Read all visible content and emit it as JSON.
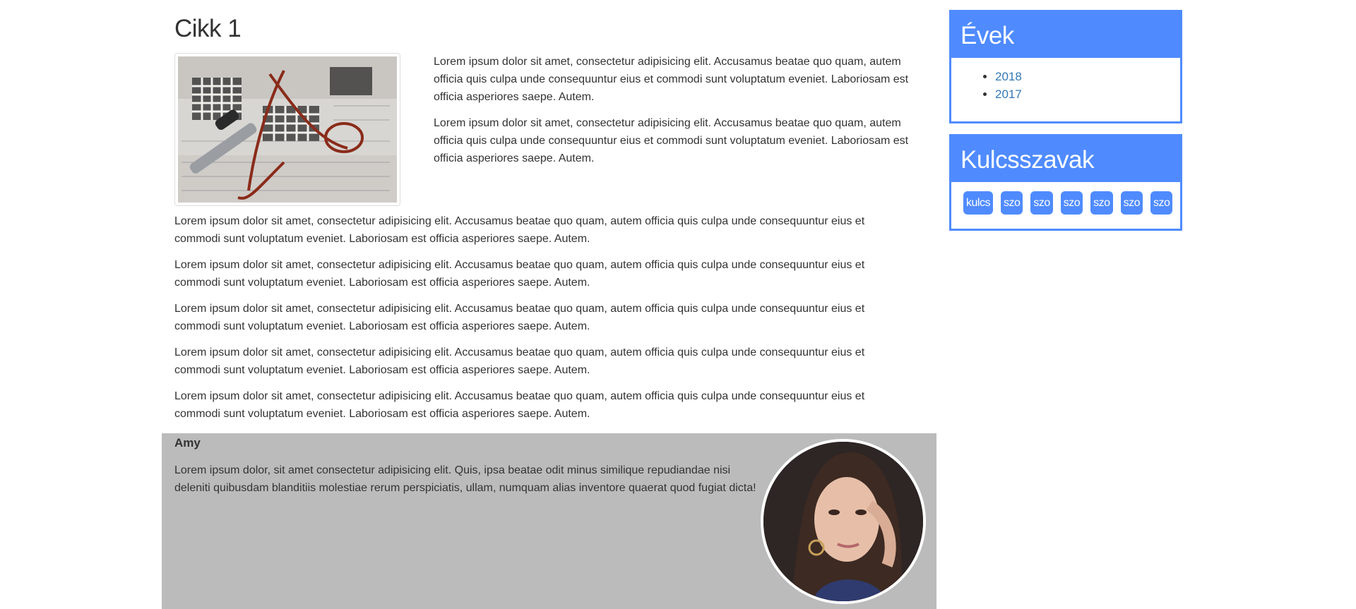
{
  "article": {
    "title": "Cikk 1",
    "image_alt": "newspaper crossword with glasses and pen",
    "intro_paragraphs": [
      "Lorem ipsum dolor sit amet, consectetur adipisicing elit. Accusamus beatae quo quam, autem officia quis culpa unde consequuntur eius et commodi sunt voluptatum eveniet. Laboriosam est officia asperiores saepe. Autem.",
      "Lorem ipsum dolor sit amet, consectetur adipisicing elit. Accusamus beatae quo quam, autem officia quis culpa unde consequuntur eius et commodi sunt voluptatum eveniet. Laboriosam est officia asperiores saepe. Autem."
    ],
    "body_paragraphs": [
      "Lorem ipsum dolor sit amet, consectetur adipisicing elit. Accusamus beatae quo quam, autem officia quis culpa unde consequuntur eius et commodi sunt voluptatum eveniet. Laboriosam est officia asperiores saepe. Autem.",
      "Lorem ipsum dolor sit amet, consectetur adipisicing elit. Accusamus beatae quo quam, autem officia quis culpa unde consequuntur eius et commodi sunt voluptatum eveniet. Laboriosam est officia asperiores saepe. Autem.",
      "Lorem ipsum dolor sit amet, consectetur adipisicing elit. Accusamus beatae quo quam, autem officia quis culpa unde consequuntur eius et commodi sunt voluptatum eveniet. Laboriosam est officia asperiores saepe. Autem.",
      "Lorem ipsum dolor sit amet, consectetur adipisicing elit. Accusamus beatae quo quam, autem officia quis culpa unde consequuntur eius et commodi sunt voluptatum eveniet. Laboriosam est officia asperiores saepe. Autem.",
      "Lorem ipsum dolor sit amet, consectetur adipisicing elit. Accusamus beatae quo quam, autem officia quis culpa unde consequuntur eius et commodi sunt voluptatum eveniet. Laboriosam est officia asperiores saepe. Autem."
    ]
  },
  "author": {
    "name": "Amy",
    "bio": "Lorem ipsum dolor, sit amet consectetur adipisicing elit. Quis, ipsa beatae odit minus similique repudiandae nisi deleniti quibusdam blanditiis molestiae rerum perspiciatis, ullam, numquam alias inventore quaerat quod fugiat dicta!",
    "avatar_alt": "portrait photo of the author"
  },
  "sidebar": {
    "years": {
      "title": "Évek",
      "items": [
        "2018",
        "2017"
      ]
    },
    "keywords": {
      "title": "Kulcsszavak",
      "tags": [
        "kulcs",
        "szo",
        "szo",
        "szo",
        "szo",
        "szo",
        "szo"
      ]
    }
  },
  "colors": {
    "accent": "#4f8bff",
    "author_bg": "#bbbbbb",
    "link": "#337ab7",
    "text": "#333333"
  }
}
